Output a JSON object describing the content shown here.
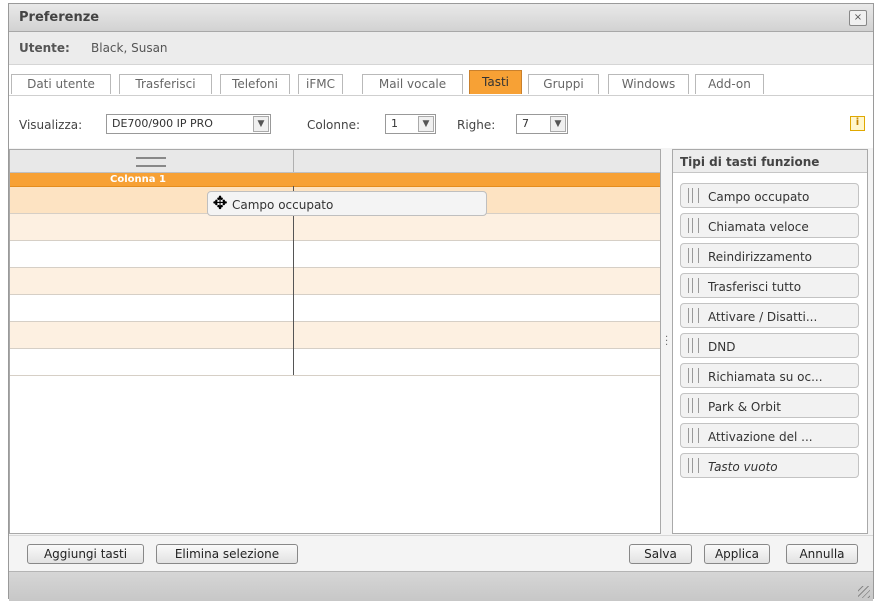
{
  "window": {
    "title": "Preferenze",
    "close_label": "×"
  },
  "user": {
    "label": "Utente:",
    "name": "Black, Susan"
  },
  "tabs": [
    {
      "label": "Dati utente"
    },
    {
      "label": "Trasferisci"
    },
    {
      "label": "Telefoni"
    },
    {
      "label": "iFMC"
    },
    {
      "label": "Mail vocale"
    },
    {
      "label": "Tasti",
      "active": true
    },
    {
      "label": "Gruppi"
    },
    {
      "label": "Windows"
    },
    {
      "label": "Add-on"
    }
  ],
  "toolbar": {
    "view_label": "Visualizza:",
    "view_value": "DE700/900 IP PRO",
    "columns_label": "Colonne:",
    "columns_value": "1",
    "rows_label": "Righe:",
    "rows_value": "7",
    "info_icon": "info-icon",
    "info_glyph": "i"
  },
  "grid": {
    "column_header": "Colonna 1",
    "dragging_label": "Campo occupato",
    "drag_icon": "move-cursor-icon"
  },
  "side": {
    "title": "Tipi di tasti funzione",
    "items": [
      {
        "label": "Campo occupato"
      },
      {
        "label": "Chiamata veloce"
      },
      {
        "label": "Reindirizzamento"
      },
      {
        "label": "Trasferisci tutto"
      },
      {
        "label": "Attivare / Disatti..."
      },
      {
        "label": "DND"
      },
      {
        "label": "Richiamata su oc..."
      },
      {
        "label": "Park & Orbit"
      },
      {
        "label": "Attivazione del ..."
      },
      {
        "label": "Tasto vuoto",
        "italic": true
      }
    ]
  },
  "footer": {
    "add_keys": "Aggiungi tasti",
    "delete_selection": "Elimina selezione",
    "save": "Salva",
    "apply": "Applica",
    "cancel": "Annulla"
  },
  "colors": {
    "accent": "#f7a135",
    "row_alt": "#fdf0e1",
    "row_selected": "#fde3c2"
  }
}
